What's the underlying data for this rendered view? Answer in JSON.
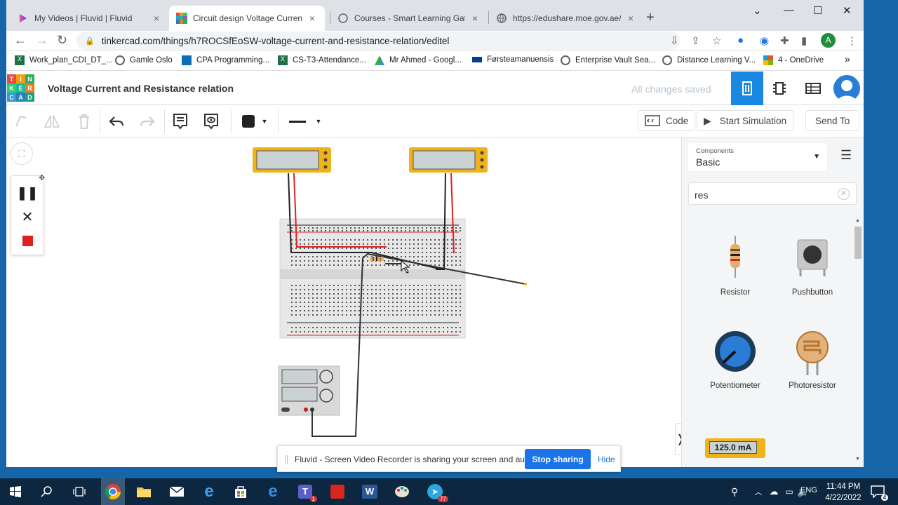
{
  "browser": {
    "tabs": [
      {
        "title": "My Videos | Fluvid | Fluvid",
        "close": "×"
      },
      {
        "title": "Circuit design Voltage Current and",
        "close": "×"
      },
      {
        "title": "Courses - Smart Learning Gateway",
        "close": "×"
      },
      {
        "title": "https://edushare.moe.gov.ae/Up",
        "close": "×"
      }
    ],
    "new_tab": "+",
    "url": "tinkercad.com/things/h7ROCSfEoSW-voltage-current-and-resistance-relation/editel",
    "profile_initial": "A",
    "bookmarks": [
      "Work_plan_CDI_DT_...",
      "Gamle Oslo",
      "CPA Programming...",
      "CS-T3-Attendance...",
      "Mr Ahmed - Googl...",
      "Førsteamanuensis",
      "Enterprise Vault Sea...",
      "Distance Learning V...",
      "4 - OneDrive"
    ],
    "bookmarks_more": "»"
  },
  "tinkercad": {
    "logo_letters": [
      "T",
      "I",
      "N",
      "K",
      "E",
      "R",
      "C",
      "A",
      "D"
    ],
    "project_title": "Voltage Current and Resistance relation",
    "save_status": "All changes saved",
    "toolbar": {
      "code_label": "Code",
      "start_sim_label": "Start Simulation",
      "send_to_label": "Send To"
    },
    "panel": {
      "components_label": "Components",
      "components_value": "Basic",
      "search_value": "res",
      "items": [
        {
          "name": "Resistor"
        },
        {
          "name": "Pushbutton"
        },
        {
          "name": "Potentiometer"
        },
        {
          "name": "Photoresistor"
        }
      ],
      "ammeter_reading": "125.0 mA"
    }
  },
  "notice": {
    "message": "Fluvid - Screen Video Recorder is sharing your screen and audio.",
    "stop_label": "Stop sharing",
    "hide_label": "Hide"
  },
  "taskbar": {
    "time": "11:44 PM",
    "date": "4/22/2022",
    "lang": "ENG",
    "teams_badge": "1",
    "telegram_badge": "77",
    "notif_count": "4"
  },
  "colors": {
    "tinkercad_blue": "#1a88e0",
    "wire_red": "#e02020",
    "multimeter_yellow": "#f0b21a"
  }
}
